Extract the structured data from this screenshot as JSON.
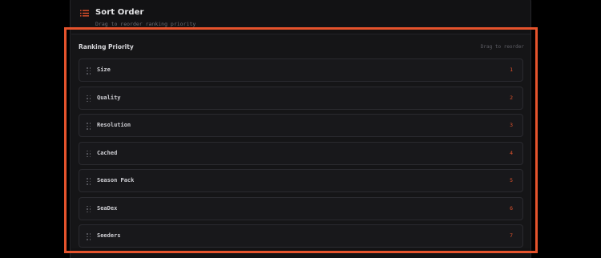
{
  "section": {
    "title": "Sort Order",
    "subtitle": "Drag to reorder ranking priority",
    "icon": "list-icon"
  },
  "panel": {
    "title": "Ranking Priority",
    "hint": "Drag to reorder"
  },
  "items": [
    {
      "label": "Size",
      "rank": "1"
    },
    {
      "label": "Quality",
      "rank": "2"
    },
    {
      "label": "Resolution",
      "rank": "3"
    },
    {
      "label": "Cached",
      "rank": "4"
    },
    {
      "label": "Season Pack",
      "rank": "5"
    },
    {
      "label": "SeaDex",
      "rank": "6"
    },
    {
      "label": "Seeders",
      "rank": "7"
    }
  ],
  "colors": {
    "accent": "#e5532c",
    "background": "#000000",
    "card": "#121214",
    "item": "#18181b",
    "border": "#2a2a2f"
  }
}
